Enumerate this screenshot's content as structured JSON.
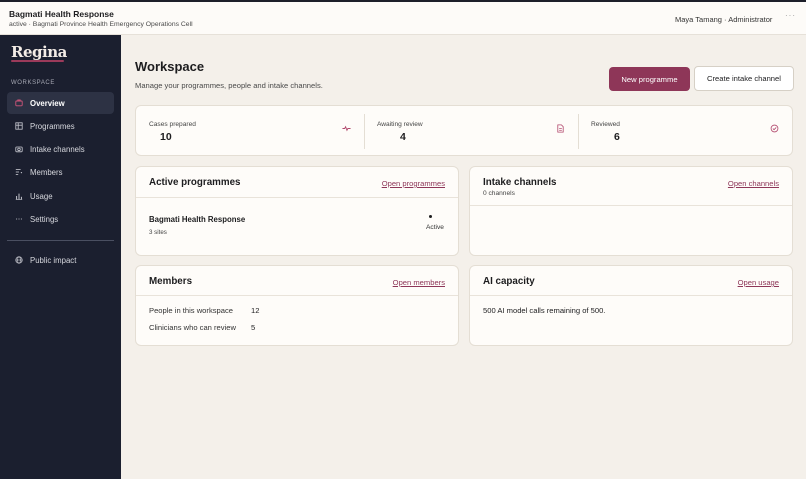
{
  "topbar": {
    "title": "Bagmati Health Response",
    "subtitle": "active · Bagmati Province Health Emergency Operations Cell",
    "user": "Maya Tamang · Administrator",
    "more": "···"
  },
  "sidebar": {
    "logo": "Regina",
    "section_label": "WORKSPACE",
    "items": [
      {
        "label": "Overview",
        "icon": "home-icon",
        "active": true
      },
      {
        "label": "Programmes",
        "icon": "table-icon"
      },
      {
        "label": "Intake channels",
        "icon": "camera-icon"
      },
      {
        "label": "Members",
        "icon": "list-filter-icon"
      },
      {
        "label": "Usage",
        "icon": "bar-chart-icon"
      },
      {
        "label": "Settings",
        "icon": "dots-icon"
      }
    ],
    "footer_items": [
      {
        "label": "Public impact",
        "icon": "globe-icon"
      }
    ]
  },
  "header": {
    "title": "Workspace",
    "subtitle": "Manage your programmes, people and intake channels.",
    "primary_button": "New programme",
    "secondary_button": "Create intake channel"
  },
  "stats": [
    {
      "label": "Cases prepared",
      "value": "10",
      "icon": "pulse-icon"
    },
    {
      "label": "Awaiting review",
      "value": "4",
      "icon": "document-icon"
    },
    {
      "label": "Reviewed",
      "value": "6",
      "icon": "check-circle-icon"
    }
  ],
  "active_programmes": {
    "title": "Active programmes",
    "link": "Open programmes",
    "items": [
      {
        "name": "Bagmati Health Response",
        "sites": "3 sites",
        "status": "Active"
      }
    ]
  },
  "intake_channels": {
    "title": "Intake channels",
    "count": "0 channels",
    "link": "Open channels"
  },
  "members": {
    "title": "Members",
    "link": "Open members",
    "rows": [
      {
        "label": "People in this workspace",
        "value": "12"
      },
      {
        "label": "Clinicians who can review",
        "value": "5"
      }
    ]
  },
  "ai_capacity": {
    "title": "AI capacity",
    "link": "Open usage",
    "text": "500 AI model calls remaining of 500."
  },
  "colors": {
    "accent": "#8e3658",
    "sidebar": "#1b1f2f",
    "background": "#f4f0ea"
  }
}
